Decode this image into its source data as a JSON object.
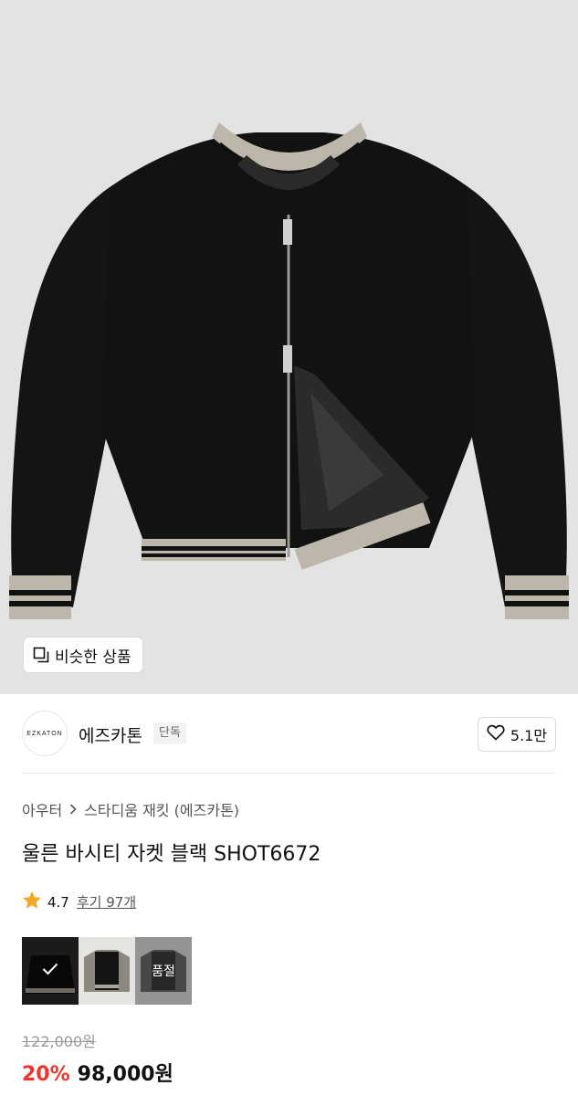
{
  "hero": {
    "image": "black-varsity-jacket-photo",
    "similar_button": {
      "icon": "similar-items-icon",
      "label": "비슷한 상품"
    }
  },
  "brand": {
    "logo_text": "EZKATON",
    "name": "에즈카톤",
    "tag": "단독",
    "likes": "5.1만",
    "like_icon": "heart-outline-icon"
  },
  "breadcrumb": {
    "category": "아우터",
    "separator_icon": "chevron-right-icon",
    "subcategory": "스타디움 재킷 (에즈카톤)"
  },
  "product": {
    "title": "울른 바시티 자켓 블랙 SHOT6672"
  },
  "rating": {
    "icon": "star-icon",
    "score": "4.7",
    "reviews": "후기 97개"
  },
  "options": [
    {
      "color": "black",
      "selected": true,
      "label": ""
    },
    {
      "color": "black-grey",
      "selected": false,
      "label": ""
    },
    {
      "color": "grey",
      "selected": false,
      "label": "품절"
    }
  ],
  "price": {
    "original": "122,000원",
    "discount": "20%",
    "final": "98,000원"
  },
  "colors": {
    "discount": "#f2352a",
    "hero_bg": "#e3e3e3",
    "star": "#f5a623"
  }
}
